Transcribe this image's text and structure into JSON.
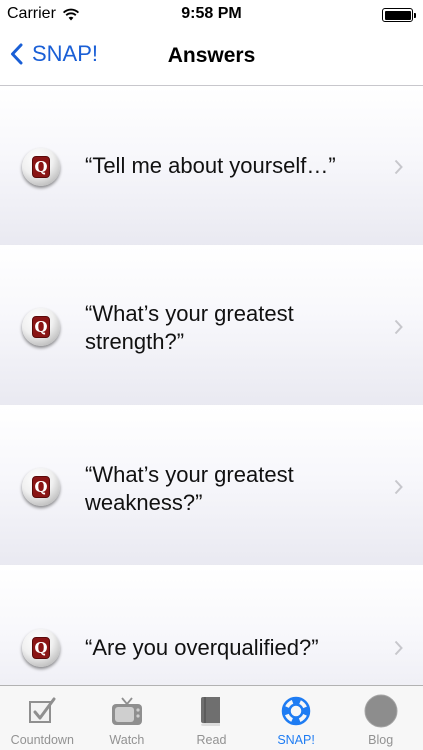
{
  "status_bar": {
    "carrier": "Carrier",
    "time": "9:58 PM",
    "wifi_icon": "wifi-icon",
    "battery_icon": "battery-icon"
  },
  "nav": {
    "back_label": "SNAP!",
    "title": "Answers",
    "accent_color": "#1a5fd6"
  },
  "questions": [
    {
      "text": "“Tell me about yourself…”",
      "icon": "q-icon"
    },
    {
      "text": "“What’s your greatest strength?”",
      "icon": "q-icon"
    },
    {
      "text": "“What’s your greatest weakness?”",
      "icon": "q-icon"
    },
    {
      "text": "“Are you overqualified?”",
      "icon": "q-icon"
    }
  ],
  "tabs": [
    {
      "label": "Countdown",
      "icon": "checkbox-icon",
      "active": false
    },
    {
      "label": "Watch",
      "icon": "tv-icon",
      "active": false
    },
    {
      "label": "Read",
      "icon": "book-icon",
      "active": false
    },
    {
      "label": "SNAP!",
      "icon": "lifebuoy-icon",
      "active": true
    },
    {
      "label": "Blog",
      "icon": "blog-icon",
      "active": false
    }
  ],
  "tab_active_color": "#1e7cf3"
}
